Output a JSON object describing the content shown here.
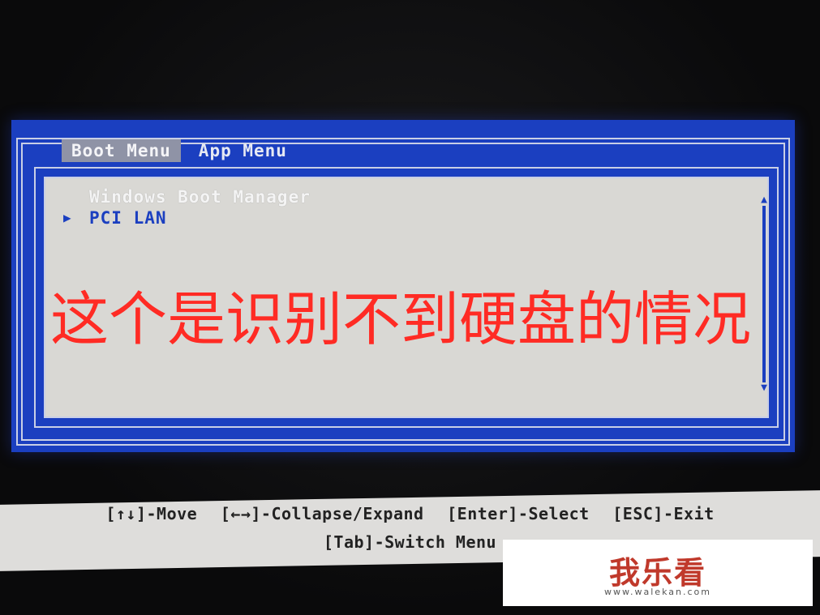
{
  "tabs": [
    {
      "label": "Boot Menu",
      "active": true
    },
    {
      "label": "App Menu",
      "active": false
    }
  ],
  "boot_items": [
    {
      "label": "Windows Boot Manager",
      "selected": false
    },
    {
      "label": "PCI LAN",
      "selected": true
    }
  ],
  "pointer_glyph": "▶",
  "scroll_up_glyph": "▲",
  "scroll_down_glyph": "▼",
  "annotation": "这个是识别不到硬盘的情况",
  "help": {
    "move": "[↑↓]-Move",
    "collapse": "[←→]-Collapse/Expand",
    "select": "[Enter]-Select",
    "exit": "[ESC]-Exit",
    "switch": "[Tab]-Switch Menu"
  },
  "watermark": {
    "logo": "我乐看",
    "url": "www.walekan.com"
  },
  "colors": {
    "bios_blue": "#1b3fc0",
    "panel_grey": "#d9d8d4",
    "annotation_red": "#ff2b24"
  }
}
